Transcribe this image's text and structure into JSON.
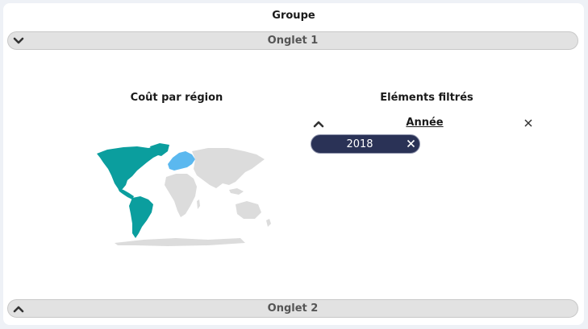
{
  "group": {
    "title": "Groupe"
  },
  "tabs": [
    {
      "label": "Onglet 1",
      "expanded": true
    },
    {
      "label": "Onglet 2",
      "expanded": false
    }
  ],
  "map_panel": {
    "title": "Coût par région",
    "colors": {
      "highlight_primary": "#0b9e9e",
      "highlight_secondary": "#5bb8ef",
      "land": "#dcdcdc"
    }
  },
  "filter_panel": {
    "title": "Eléments filtrés",
    "field": "Année",
    "chips": [
      {
        "label": "2018"
      }
    ]
  },
  "colors": {
    "chip_bg": "#2a3256",
    "bar_bg": "#e2e2e2"
  }
}
